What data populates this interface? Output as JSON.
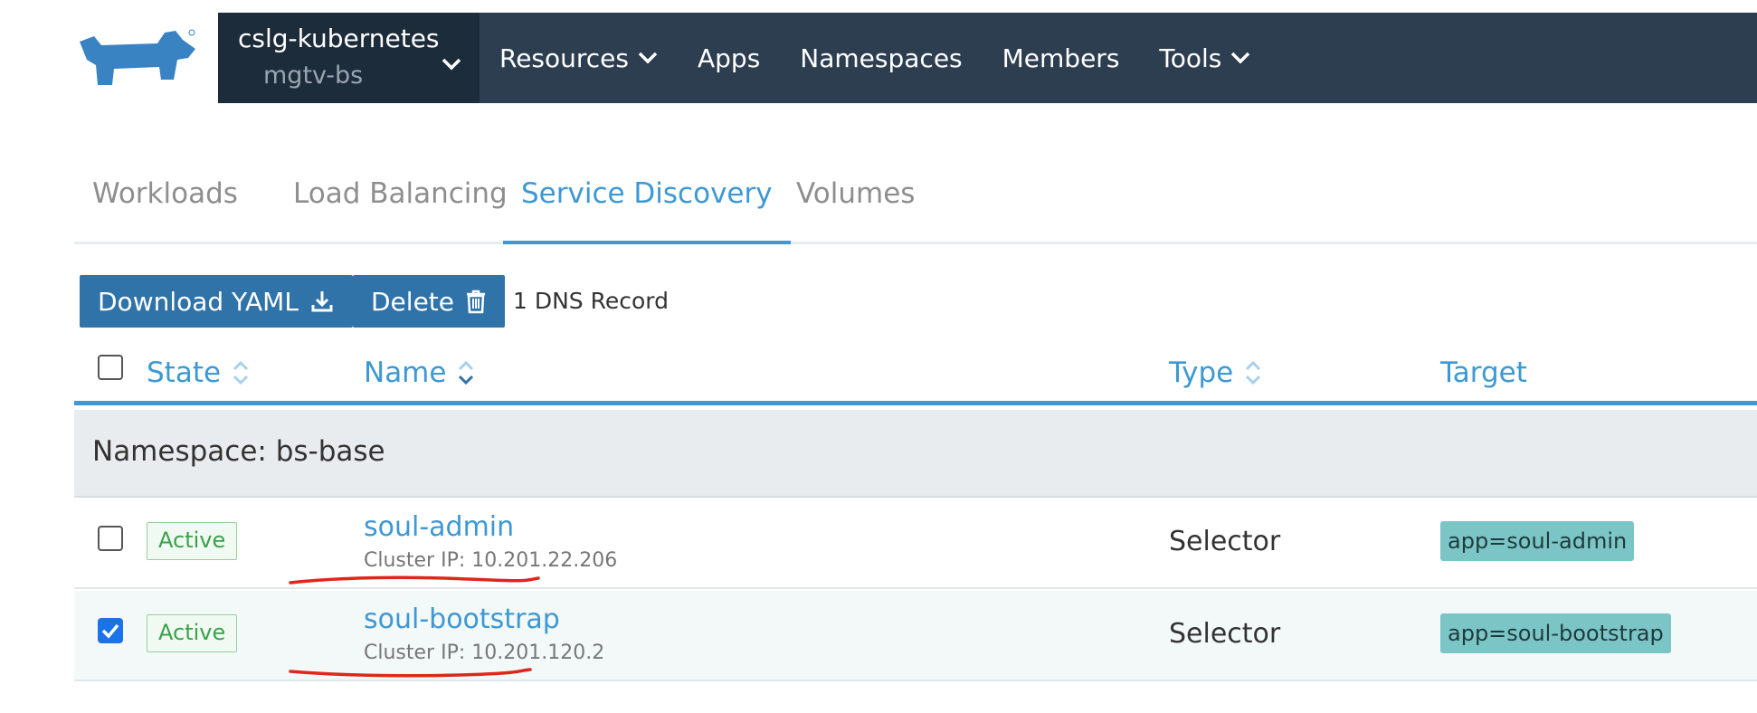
{
  "header": {
    "logo_icon": "rancher-cow-logo",
    "cluster_name": "cslg-kubernetes",
    "project_name": "mgtv-bs",
    "nav": [
      {
        "label": "Resources",
        "has_dropdown": true
      },
      {
        "label": "Apps",
        "has_dropdown": false
      },
      {
        "label": "Namespaces",
        "has_dropdown": false
      },
      {
        "label": "Members",
        "has_dropdown": false
      },
      {
        "label": "Tools",
        "has_dropdown": true
      }
    ]
  },
  "tabs": [
    {
      "label": "Workloads",
      "active": false
    },
    {
      "label": "Load Balancing",
      "active": false
    },
    {
      "label": "Service Discovery",
      "active": true
    },
    {
      "label": "Volumes",
      "active": false
    }
  ],
  "toolbar": {
    "download_label": "Download YAML",
    "download_icon": "download-icon",
    "delete_label": "Delete",
    "delete_icon": "trash-icon",
    "selection_count": "1 DNS Record"
  },
  "table": {
    "columns": [
      {
        "label": "State",
        "sortable": true
      },
      {
        "label": "Name",
        "sortable": true
      },
      {
        "label": "Type",
        "sortable": true
      },
      {
        "label": "Target",
        "sortable": false
      }
    ],
    "group_label": "Namespace: bs-base",
    "rows": [
      {
        "checked": false,
        "state": "Active",
        "name": "soul-admin",
        "cluster_ip": "Cluster IP: 10.201.22.206",
        "type": "Selector",
        "target": "app=soul-admin"
      },
      {
        "checked": true,
        "state": "Active",
        "name": "soul-bootstrap",
        "cluster_ip": "Cluster IP: 10.201.120.2",
        "type": "Selector",
        "target": "app=soul-bootstrap"
      }
    ]
  },
  "colors": {
    "nav_bg": "#2d3e50",
    "cluster_bg": "#1d2c3b",
    "accent": "#3d98d3",
    "button_bg": "#2f73a8",
    "active_green": "#3aa14c",
    "target_tag": "#7cc5c7",
    "annotation_red": "#e0261b"
  }
}
